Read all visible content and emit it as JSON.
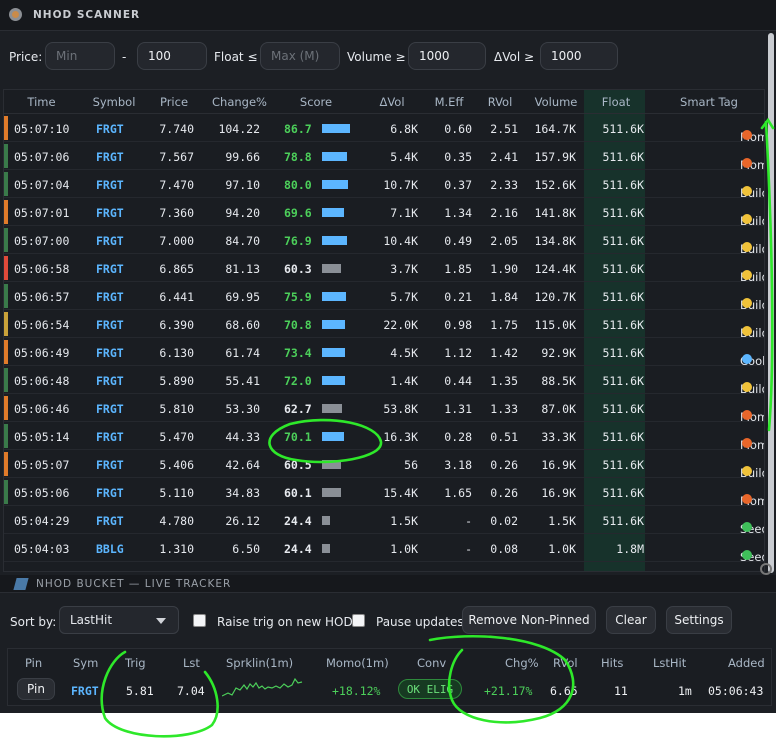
{
  "scanner": {
    "title": "NHOD SCANNER",
    "filters": {
      "price_label": "Price:",
      "price_min_placeholder": "Min",
      "dash": "-",
      "price_max_value": "100",
      "float_label": "Float ≤",
      "float_placeholder": "Max (M)",
      "volume_label": "Volume ≥",
      "volume_value": "1000",
      "dvol_label": "ΔVol ≥",
      "dvol_value": "1000"
    },
    "columns": [
      "Time",
      "Symbol",
      "Price",
      "Change%",
      "Score",
      "ΔVol",
      "M.Eff",
      "RVol",
      "Volume",
      "Float",
      "Smart Tag"
    ],
    "rows": [
      {
        "time": "05:07:10",
        "symbol": "FRGT",
        "price": "7.740",
        "change": "104.22",
        "score": "86.7",
        "score_level": 0.87,
        "dvol": "6.8K",
        "meff": "0.60",
        "rvol": "2.51",
        "volume": "164.7K",
        "float": "511.6K",
        "tag": "Momentum",
        "tag_kind": "fire",
        "bar_color": "#e07b2a",
        "score_color": "#4ccf5a"
      },
      {
        "time": "05:07:06",
        "symbol": "FRGT",
        "price": "7.567",
        "change": "99.66",
        "score": "78.8",
        "score_level": 0.79,
        "dvol": "5.4K",
        "meff": "0.35",
        "rvol": "2.41",
        "volume": "157.9K",
        "float": "511.6K",
        "tag": "Momentum",
        "tag_kind": "fire",
        "bar_color": "#3a7a4a",
        "score_color": "#4ccf5a"
      },
      {
        "time": "05:07:04",
        "symbol": "FRGT",
        "price": "7.470",
        "change": "97.10",
        "score": "80.0",
        "score_level": 0.8,
        "dvol": "10.7K",
        "meff": "0.37",
        "rvol": "2.33",
        "volume": "152.6K",
        "float": "511.6K",
        "tag": "BuildUp",
        "tag_kind": "sun",
        "bar_color": "#3a7a4a",
        "score_color": "#4ccf5a"
      },
      {
        "time": "05:07:01",
        "symbol": "FRGT",
        "price": "7.360",
        "change": "94.20",
        "score": "69.6",
        "score_level": 0.7,
        "dvol": "7.1K",
        "meff": "1.34",
        "rvol": "2.16",
        "volume": "141.8K",
        "float": "511.6K",
        "tag": "BuildUp",
        "tag_kind": "sun",
        "bar_color": "#e07b2a",
        "score_color": "#4ccf5a"
      },
      {
        "time": "05:07:00",
        "symbol": "FRGT",
        "price": "7.000",
        "change": "84.70",
        "score": "76.9",
        "score_level": 0.77,
        "dvol": "10.4K",
        "meff": "0.49",
        "rvol": "2.05",
        "volume": "134.8K",
        "float": "511.6K",
        "tag": "BuildUp",
        "tag_kind": "sun",
        "bar_color": "#3a7a4a",
        "score_color": "#4ccf5a"
      },
      {
        "time": "05:06:58",
        "symbol": "FRGT",
        "price": "6.865",
        "change": "81.13",
        "score": "60.3",
        "score_level": 0.6,
        "dvol": "3.7K",
        "meff": "1.85",
        "rvol": "1.90",
        "volume": "124.4K",
        "float": "511.6K",
        "tag": "BuildUp",
        "tag_kind": "sun",
        "bar_color": "#e04a3a",
        "score_color": "#e6e9ee"
      },
      {
        "time": "05:06:57",
        "symbol": "FRGT",
        "price": "6.441",
        "change": "69.95",
        "score": "75.9",
        "score_level": 0.76,
        "dvol": "5.7K",
        "meff": "0.21",
        "rvol": "1.84",
        "volume": "120.7K",
        "float": "511.6K",
        "tag": "BuildUp",
        "tag_kind": "sun",
        "bar_color": "#3a7a4a",
        "score_color": "#4ccf5a"
      },
      {
        "time": "05:06:54",
        "symbol": "FRGT",
        "price": "6.390",
        "change": "68.60",
        "score": "70.8",
        "score_level": 0.71,
        "dvol": "22.0K",
        "meff": "0.98",
        "rvol": "1.75",
        "volume": "115.0K",
        "float": "511.6K",
        "tag": "BuildUp",
        "tag_kind": "sun",
        "bar_color": "#c9a23a",
        "score_color": "#4ccf5a"
      },
      {
        "time": "05:06:49",
        "symbol": "FRGT",
        "price": "6.130",
        "change": "61.74",
        "score": "73.4",
        "score_level": 0.73,
        "dvol": "4.5K",
        "meff": "1.12",
        "rvol": "1.42",
        "volume": "92.9K",
        "float": "511.6K",
        "tag": "Cooling",
        "tag_kind": "ice",
        "bar_color": "#e07b2a",
        "score_color": "#4ccf5a"
      },
      {
        "time": "05:06:48",
        "symbol": "FRGT",
        "price": "5.890",
        "change": "55.41",
        "score": "72.0",
        "score_level": 0.72,
        "dvol": "1.4K",
        "meff": "0.44",
        "rvol": "1.35",
        "volume": "88.5K",
        "float": "511.6K",
        "tag": "BuildUp",
        "tag_kind": "sun",
        "bar_color": "#3a7a4a",
        "score_color": "#4ccf5a"
      },
      {
        "time": "05:06:46",
        "symbol": "FRGT",
        "price": "5.810",
        "change": "53.30",
        "score": "62.7",
        "score_level": 0.63,
        "dvol": "53.8K",
        "meff": "1.31",
        "rvol": "1.33",
        "volume": "87.0K",
        "float": "511.6K",
        "tag": "Momentum",
        "tag_kind": "fire",
        "bar_color": "#e07b2a",
        "score_color": "#e6e9ee"
      },
      {
        "time": "05:05:14",
        "symbol": "FRGT",
        "price": "5.470",
        "change": "44.33",
        "score": "70.1",
        "score_level": 0.7,
        "dvol": "16.3K",
        "meff": "0.28",
        "rvol": "0.51",
        "volume": "33.3K",
        "float": "511.6K",
        "tag": "Momentum",
        "tag_kind": "fire",
        "bar_color": "#3a7a4a",
        "score_color": "#4ccf5a"
      },
      {
        "time": "05:05:07",
        "symbol": "FRGT",
        "price": "5.406",
        "change": "42.64",
        "score": "60.5",
        "score_level": 0.6,
        "dvol": "56",
        "meff": "3.18",
        "rvol": "0.26",
        "volume": "16.9K",
        "float": "511.6K",
        "tag": "BuildUp",
        "tag_kind": "sun",
        "bar_color": "#e07b2a",
        "score_color": "#e6e9ee"
      },
      {
        "time": "05:05:06",
        "symbol": "FRGT",
        "price": "5.110",
        "change": "34.83",
        "score": "60.1",
        "score_level": 0.6,
        "dvol": "15.4K",
        "meff": "1.65",
        "rvol": "0.26",
        "volume": "16.9K",
        "float": "511.6K",
        "tag": "Momentum",
        "tag_kind": "fire",
        "bar_color": "#3a7a4a",
        "score_color": "#e6e9ee"
      },
      {
        "time": "05:04:29",
        "symbol": "FRGT",
        "price": "4.780",
        "change": "26.12",
        "score": "24.4",
        "score_level": 0.24,
        "dvol": "1.5K",
        "meff": "-",
        "rvol": "0.02",
        "volume": "1.5K",
        "float": "511.6K",
        "tag": "Seed",
        "tag_kind": "seed",
        "bar_color": "",
        "score_color": "#e6e9ee"
      },
      {
        "time": "05:04:03",
        "symbol": "BBLG",
        "price": "1.310",
        "change": "6.50",
        "score": "24.4",
        "score_level": 0.24,
        "dvol": "1.0K",
        "meff": "-",
        "rvol": "0.08",
        "volume": "1.0K",
        "float": "1.8M",
        "tag": "Seed",
        "tag_kind": "seed",
        "bar_color": "",
        "score_color": "#e6e9ee"
      }
    ]
  },
  "bucket": {
    "title": "NHOD BUCKET — LIVE TRACKER",
    "sort_label": "Sort by:",
    "sort_value": "LastHit",
    "raise_trig_label": "Raise trig on new HOD",
    "pause_label": "Pause updates",
    "remove_button": "Remove Non-Pinned",
    "clear_button": "Clear",
    "settings_button": "Settings",
    "columns": [
      "Pin",
      "Sym",
      "Trig",
      "Lst",
      "Sprklin(1m)",
      "Momo(1m)",
      "Conv",
      "Chg%",
      "RVol",
      "Hits",
      "LstHit",
      "Added"
    ],
    "row": {
      "pin": "Pin",
      "sym": "FRGT",
      "trig": "5.81",
      "lst": "7.04",
      "momo": "+18.12%",
      "conv": "OK ELIG",
      "chg": "+21.17%",
      "rvol": "6.65",
      "hits": "11",
      "lsthit": "1m",
      "added": "05:06:43"
    }
  },
  "colors": {
    "accent_green": "#2ee82a",
    "symbol_blue": "#5cb6ff",
    "positive": "#4ccf5a",
    "float_bg": "#17322b"
  }
}
